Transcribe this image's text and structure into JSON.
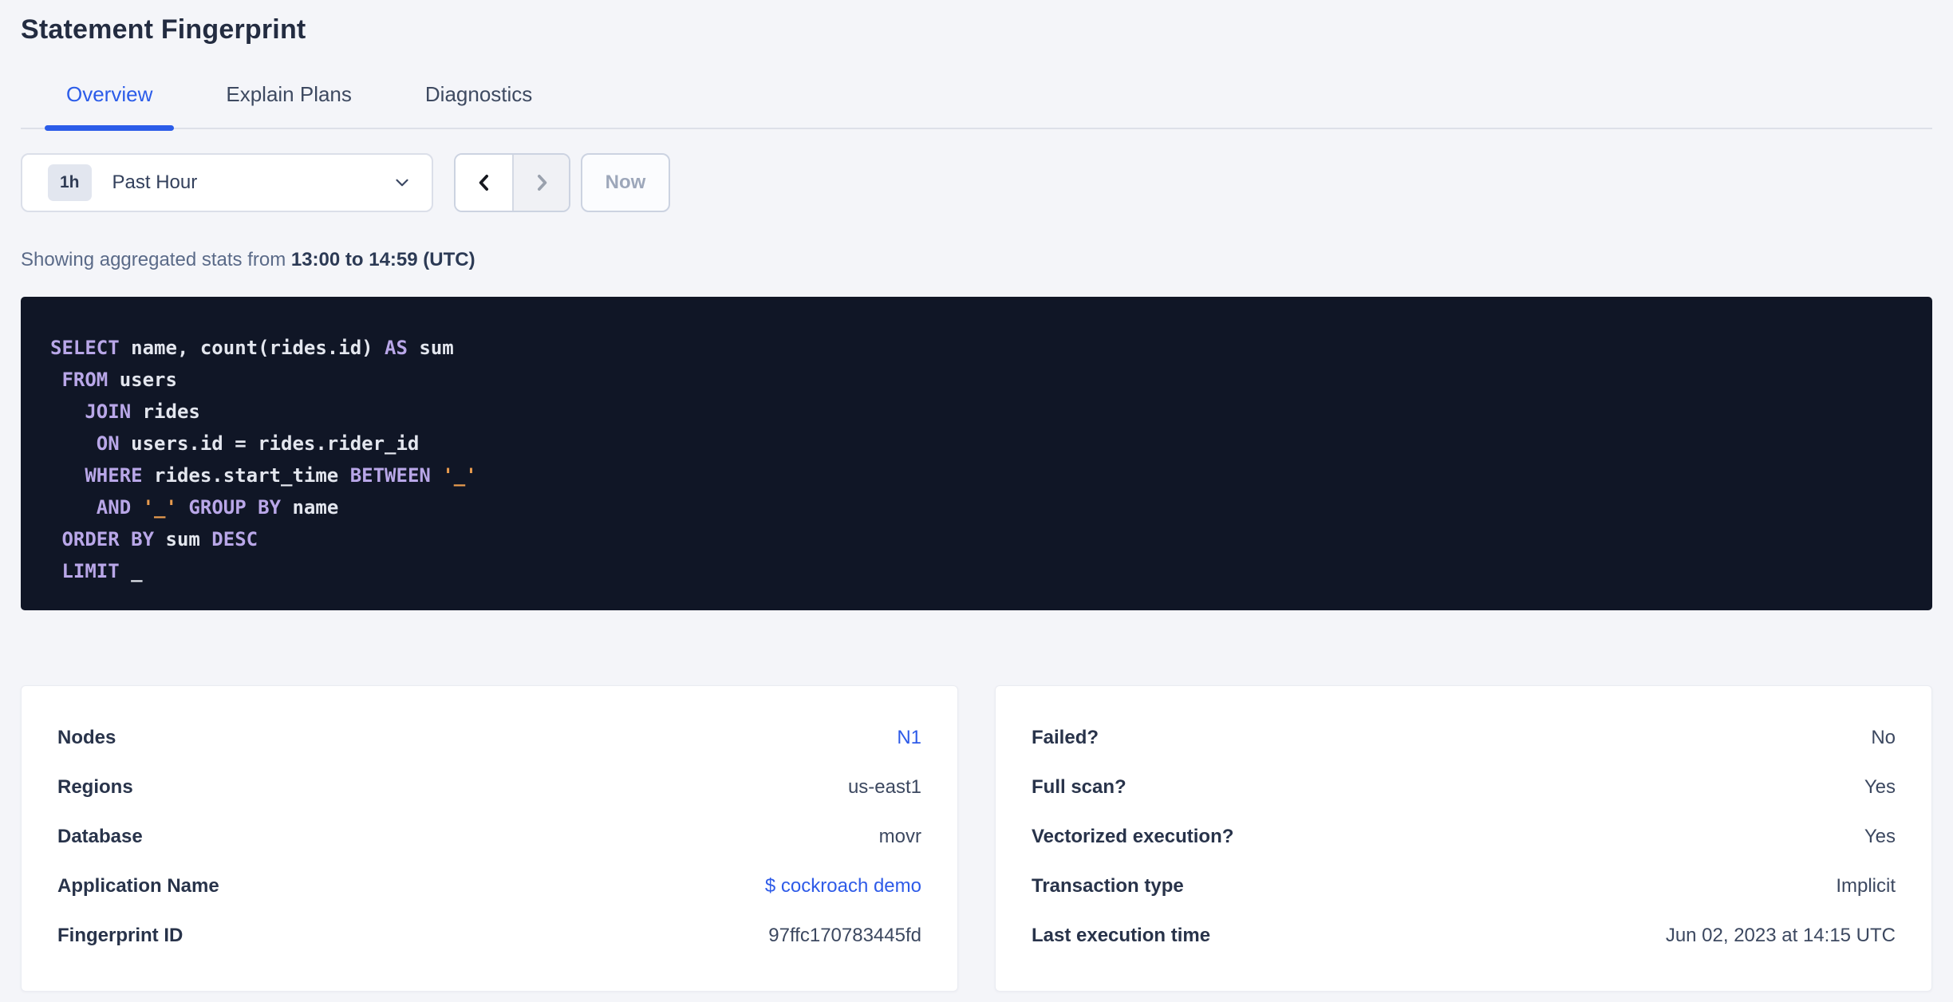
{
  "header": {
    "title": "Statement Fingerprint"
  },
  "tabs": [
    {
      "label": "Overview",
      "active": true
    },
    {
      "label": "Explain Plans",
      "active": false
    },
    {
      "label": "Diagnostics",
      "active": false
    }
  ],
  "controls": {
    "time_range": {
      "badge": "1h",
      "label": "Past Hour"
    },
    "prev_icon": "chevron-left-icon",
    "next_icon": "chevron-right-icon",
    "dropdown_icon": "chevron-down-icon",
    "now_label": "Now",
    "next_disabled": true
  },
  "stats_line": {
    "prefix": "Showing aggregated stats from ",
    "range": "13:00 to 14:59 (UTC)"
  },
  "sql": {
    "lines": [
      [
        {
          "t": "kw",
          "v": "SELECT"
        },
        {
          "t": "id",
          "v": " name, count(rides.id) "
        },
        {
          "t": "kw",
          "v": "AS"
        },
        {
          "t": "id",
          "v": " sum"
        }
      ],
      [
        {
          "t": "id",
          "v": " "
        },
        {
          "t": "kw",
          "v": "FROM"
        },
        {
          "t": "id",
          "v": " users"
        }
      ],
      [
        {
          "t": "id",
          "v": "   "
        },
        {
          "t": "kw",
          "v": "JOIN"
        },
        {
          "t": "id",
          "v": " rides"
        }
      ],
      [
        {
          "t": "id",
          "v": "    "
        },
        {
          "t": "kw",
          "v": "ON"
        },
        {
          "t": "id",
          "v": " users.id = rides.rider_id"
        }
      ],
      [
        {
          "t": "id",
          "v": "   "
        },
        {
          "t": "kw",
          "v": "WHERE"
        },
        {
          "t": "id",
          "v": " rides.start_time "
        },
        {
          "t": "kw",
          "v": "BETWEEN"
        },
        {
          "t": "id",
          "v": " "
        },
        {
          "t": "str",
          "v": "'_'"
        }
      ],
      [
        {
          "t": "id",
          "v": "    "
        },
        {
          "t": "kw",
          "v": "AND"
        },
        {
          "t": "id",
          "v": " "
        },
        {
          "t": "str",
          "v": "'_'"
        },
        {
          "t": "id",
          "v": " "
        },
        {
          "t": "kw",
          "v": "GROUP BY"
        },
        {
          "t": "id",
          "v": " name"
        }
      ],
      [
        {
          "t": "id",
          "v": " "
        },
        {
          "t": "kw",
          "v": "ORDER BY"
        },
        {
          "t": "id",
          "v": " sum "
        },
        {
          "t": "kw",
          "v": "DESC"
        }
      ],
      [
        {
          "t": "id",
          "v": " "
        },
        {
          "t": "kw",
          "v": "LIMIT"
        },
        {
          "t": "id",
          "v": " _"
        }
      ]
    ]
  },
  "cards": {
    "left": {
      "rows": [
        {
          "label": "Nodes",
          "value": "N1",
          "link": true
        },
        {
          "label": "Regions",
          "value": "us-east1",
          "link": false
        },
        {
          "label": "Database",
          "value": "movr",
          "link": false
        },
        {
          "label": "Application Name",
          "value": "$ cockroach demo",
          "link": true
        },
        {
          "label": "Fingerprint ID",
          "value": "97ffc170783445fd",
          "link": false
        }
      ]
    },
    "right": {
      "rows": [
        {
          "label": "Failed?",
          "value": "No",
          "link": false
        },
        {
          "label": "Full scan?",
          "value": "Yes",
          "link": false
        },
        {
          "label": "Vectorized execution?",
          "value": "Yes",
          "link": false
        },
        {
          "label": "Transaction type",
          "value": "Implicit",
          "link": false
        },
        {
          "label": "Last execution time",
          "value": "Jun 02, 2023 at 14:15 UTC",
          "link": false
        }
      ]
    }
  },
  "colors": {
    "accent": "#2b5ce9",
    "link": "#2e5be8",
    "sql_background": "#101626",
    "sql_keyword": "#b9a7e8",
    "sql_identifier": "#e3e6ee",
    "sql_string": "#e89b4e"
  }
}
